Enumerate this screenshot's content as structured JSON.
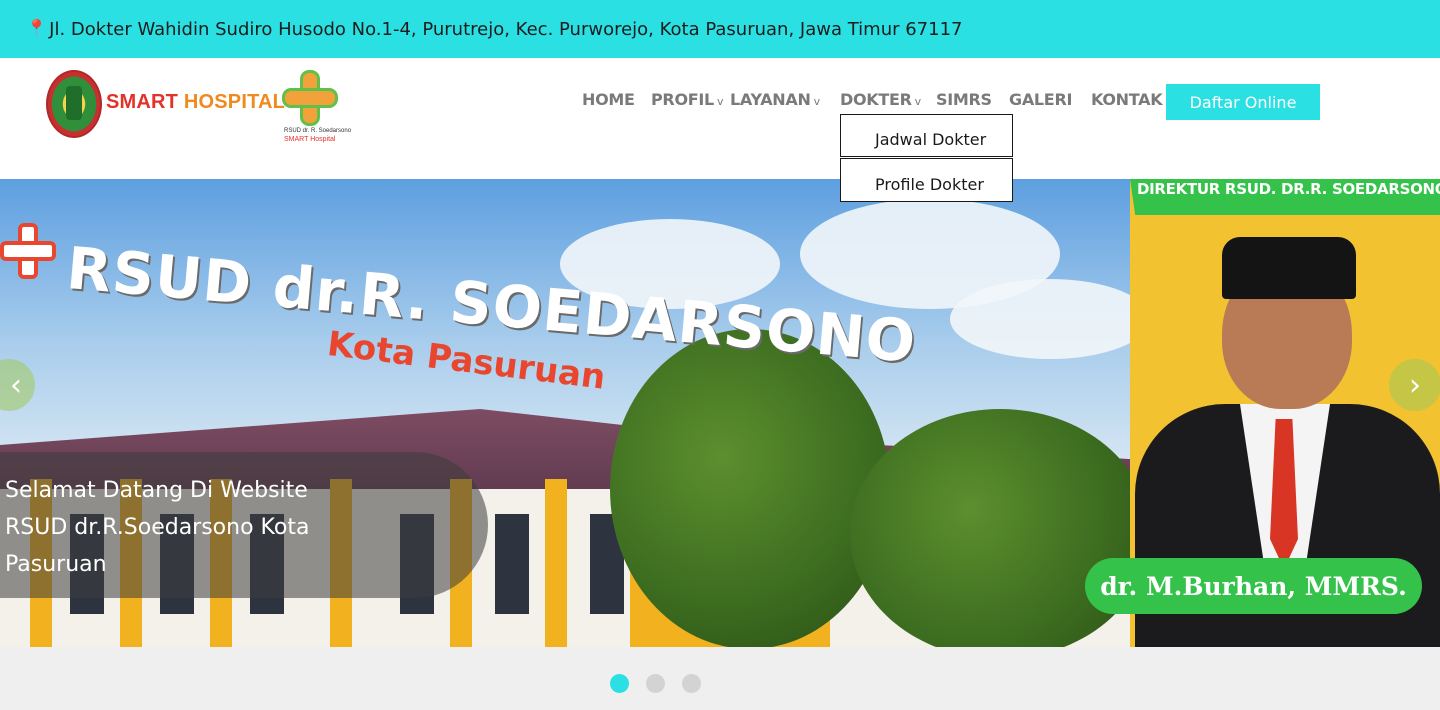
{
  "topbar": {
    "pin_icon": "location-pin-icon",
    "address": "Jl. Dokter Wahidin Sudiro Husodo No.1-4, Purutrejo, Kec. Purworejo, Kota Pasuruan, Jawa Timur 67117"
  },
  "logo": {
    "brand_part1": "SMART",
    "brand_part2": " HOSPITAL",
    "sub1": "RSUD dr. R. Soedarsono",
    "sub2": "SMART Hospital"
  },
  "nav": {
    "items": [
      {
        "label": "HOME",
        "has_caret": false
      },
      {
        "label": "PROFIL",
        "has_caret": true
      },
      {
        "label": "LAYANAN",
        "has_caret": true
      },
      {
        "label": "DOKTER",
        "has_caret": true
      },
      {
        "label": "SIMRS",
        "has_caret": false
      },
      {
        "label": "GALERI",
        "has_caret": false
      },
      {
        "label": "KONTAK",
        "has_caret": false
      }
    ],
    "caret_glyph": "v",
    "cta_label": "Daftar Online"
  },
  "dropdown": {
    "items": [
      "Jadwal Dokter",
      "Profile Dokter"
    ]
  },
  "hero": {
    "sign_text": "RSUD dr.R. SOEDARSONO",
    "sign_sub": "Kota Pasuruan",
    "director_title": "DIREKTUR RSUD. DR.R. SOEDARSONO",
    "director_name": "dr. M.Burhan, MMRS.",
    "welcome_lines": [
      "Selamat Datang Di Website",
      "RSUD dr.R.Soedarsono Kota",
      "Pasuruan"
    ],
    "prev_glyph": "‹",
    "next_glyph": "›"
  },
  "carousel": {
    "slide_count": 3,
    "active_index": 0
  },
  "colors": {
    "accent": "#2ae0e3",
    "brand_red": "#e4322b",
    "brand_orange": "#f08a1e",
    "nav_text": "#7a7a7a",
    "badge_green": "#35c24a"
  }
}
